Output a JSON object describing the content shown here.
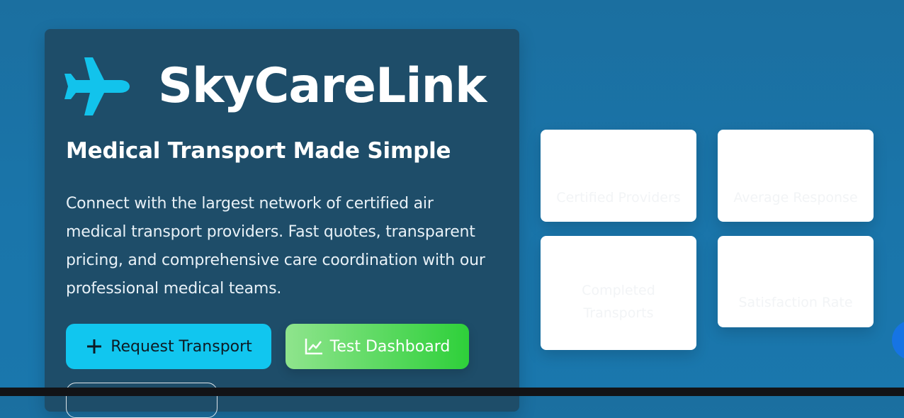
{
  "brand": {
    "name": "SkyCareLink",
    "icon": "airplane-icon",
    "icon_color": "#12c3ec"
  },
  "hero": {
    "tagline": "Medical Transport Made Simple",
    "description": "Connect with the largest network of certified air medical transport providers. Fast quotes, transparent pricing, and comprehensive care coordination with our professional medical teams."
  },
  "actions": {
    "request_label": "Request Transport",
    "request_icon": "plus-icon",
    "dashboard_label": "Test Dashboard",
    "dashboard_icon": "line-chart-icon"
  },
  "stats": [
    {
      "label": "Certified Providers"
    },
    {
      "label": "Average Response"
    },
    {
      "label": "Completed Transports"
    },
    {
      "label": "Satisfaction Rate"
    }
  ],
  "colors": {
    "background": "#1a73a8",
    "card": "#1e4d69",
    "request_button": "#11c6ef",
    "dashboard_button_start": "#8fe48d",
    "dashboard_button_end": "#2ed03a"
  }
}
